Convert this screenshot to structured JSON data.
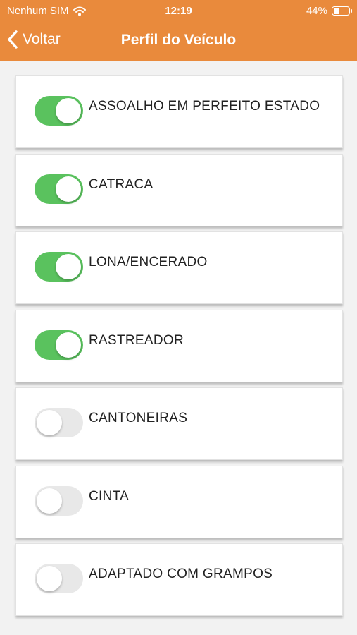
{
  "status_bar": {
    "carrier": "Nenhum SIM",
    "time": "12:19",
    "battery": "44%",
    "battery_level": 0.44
  },
  "nav": {
    "back_label": "Voltar",
    "title": "Perfil do Veículo"
  },
  "options": [
    {
      "label": "ASSOALHO EM PERFEITO ESTADO",
      "enabled": true
    },
    {
      "label": "CATRACA",
      "enabled": true
    },
    {
      "label": "LONA/ENCERADO",
      "enabled": true
    },
    {
      "label": "RASTREADOR",
      "enabled": true
    },
    {
      "label": "CANTONEIRAS",
      "enabled": false
    },
    {
      "label": "CINTA",
      "enabled": false
    },
    {
      "label": "ADAPTADO COM GRAMPOS",
      "enabled": false
    }
  ],
  "colors": {
    "header": "#e98a3c",
    "toggle_on": "#5ac25e",
    "toggle_off": "#e8e8e8"
  }
}
